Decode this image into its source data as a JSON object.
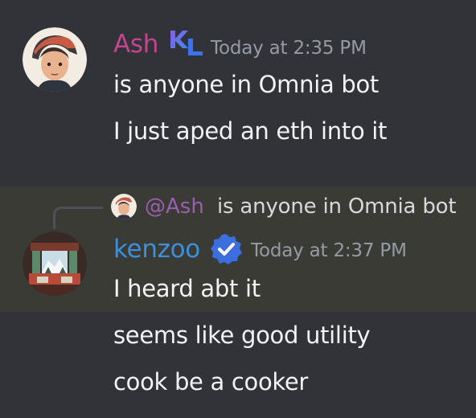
{
  "messages": [
    {
      "username": "Ash",
      "username_color": "#c2458f",
      "badge_text": "KL",
      "timestamp": "Today at 2:35 PM",
      "lines": [
        "is anyone in Omnia bot",
        "I just aped an eth into it"
      ]
    },
    {
      "username": "kenzoo",
      "username_color": "#3c8fd8",
      "timestamp": "Today at 2:37 PM",
      "reply": {
        "mention": "@Ash",
        "text": "is anyone in Omnia bot"
      },
      "lines": [
        "I heard abt it",
        "seems like good utility",
        "cook be a cooker"
      ]
    }
  ],
  "colors": {
    "background": "#313338",
    "highlight": "#3b3b36",
    "timestamp": "#949ba4",
    "verified_badge": "#3c6ee0"
  },
  "icons": {
    "badge_1": "kl-gradient-badge-icon",
    "badge_2": "verified-check-icon"
  }
}
